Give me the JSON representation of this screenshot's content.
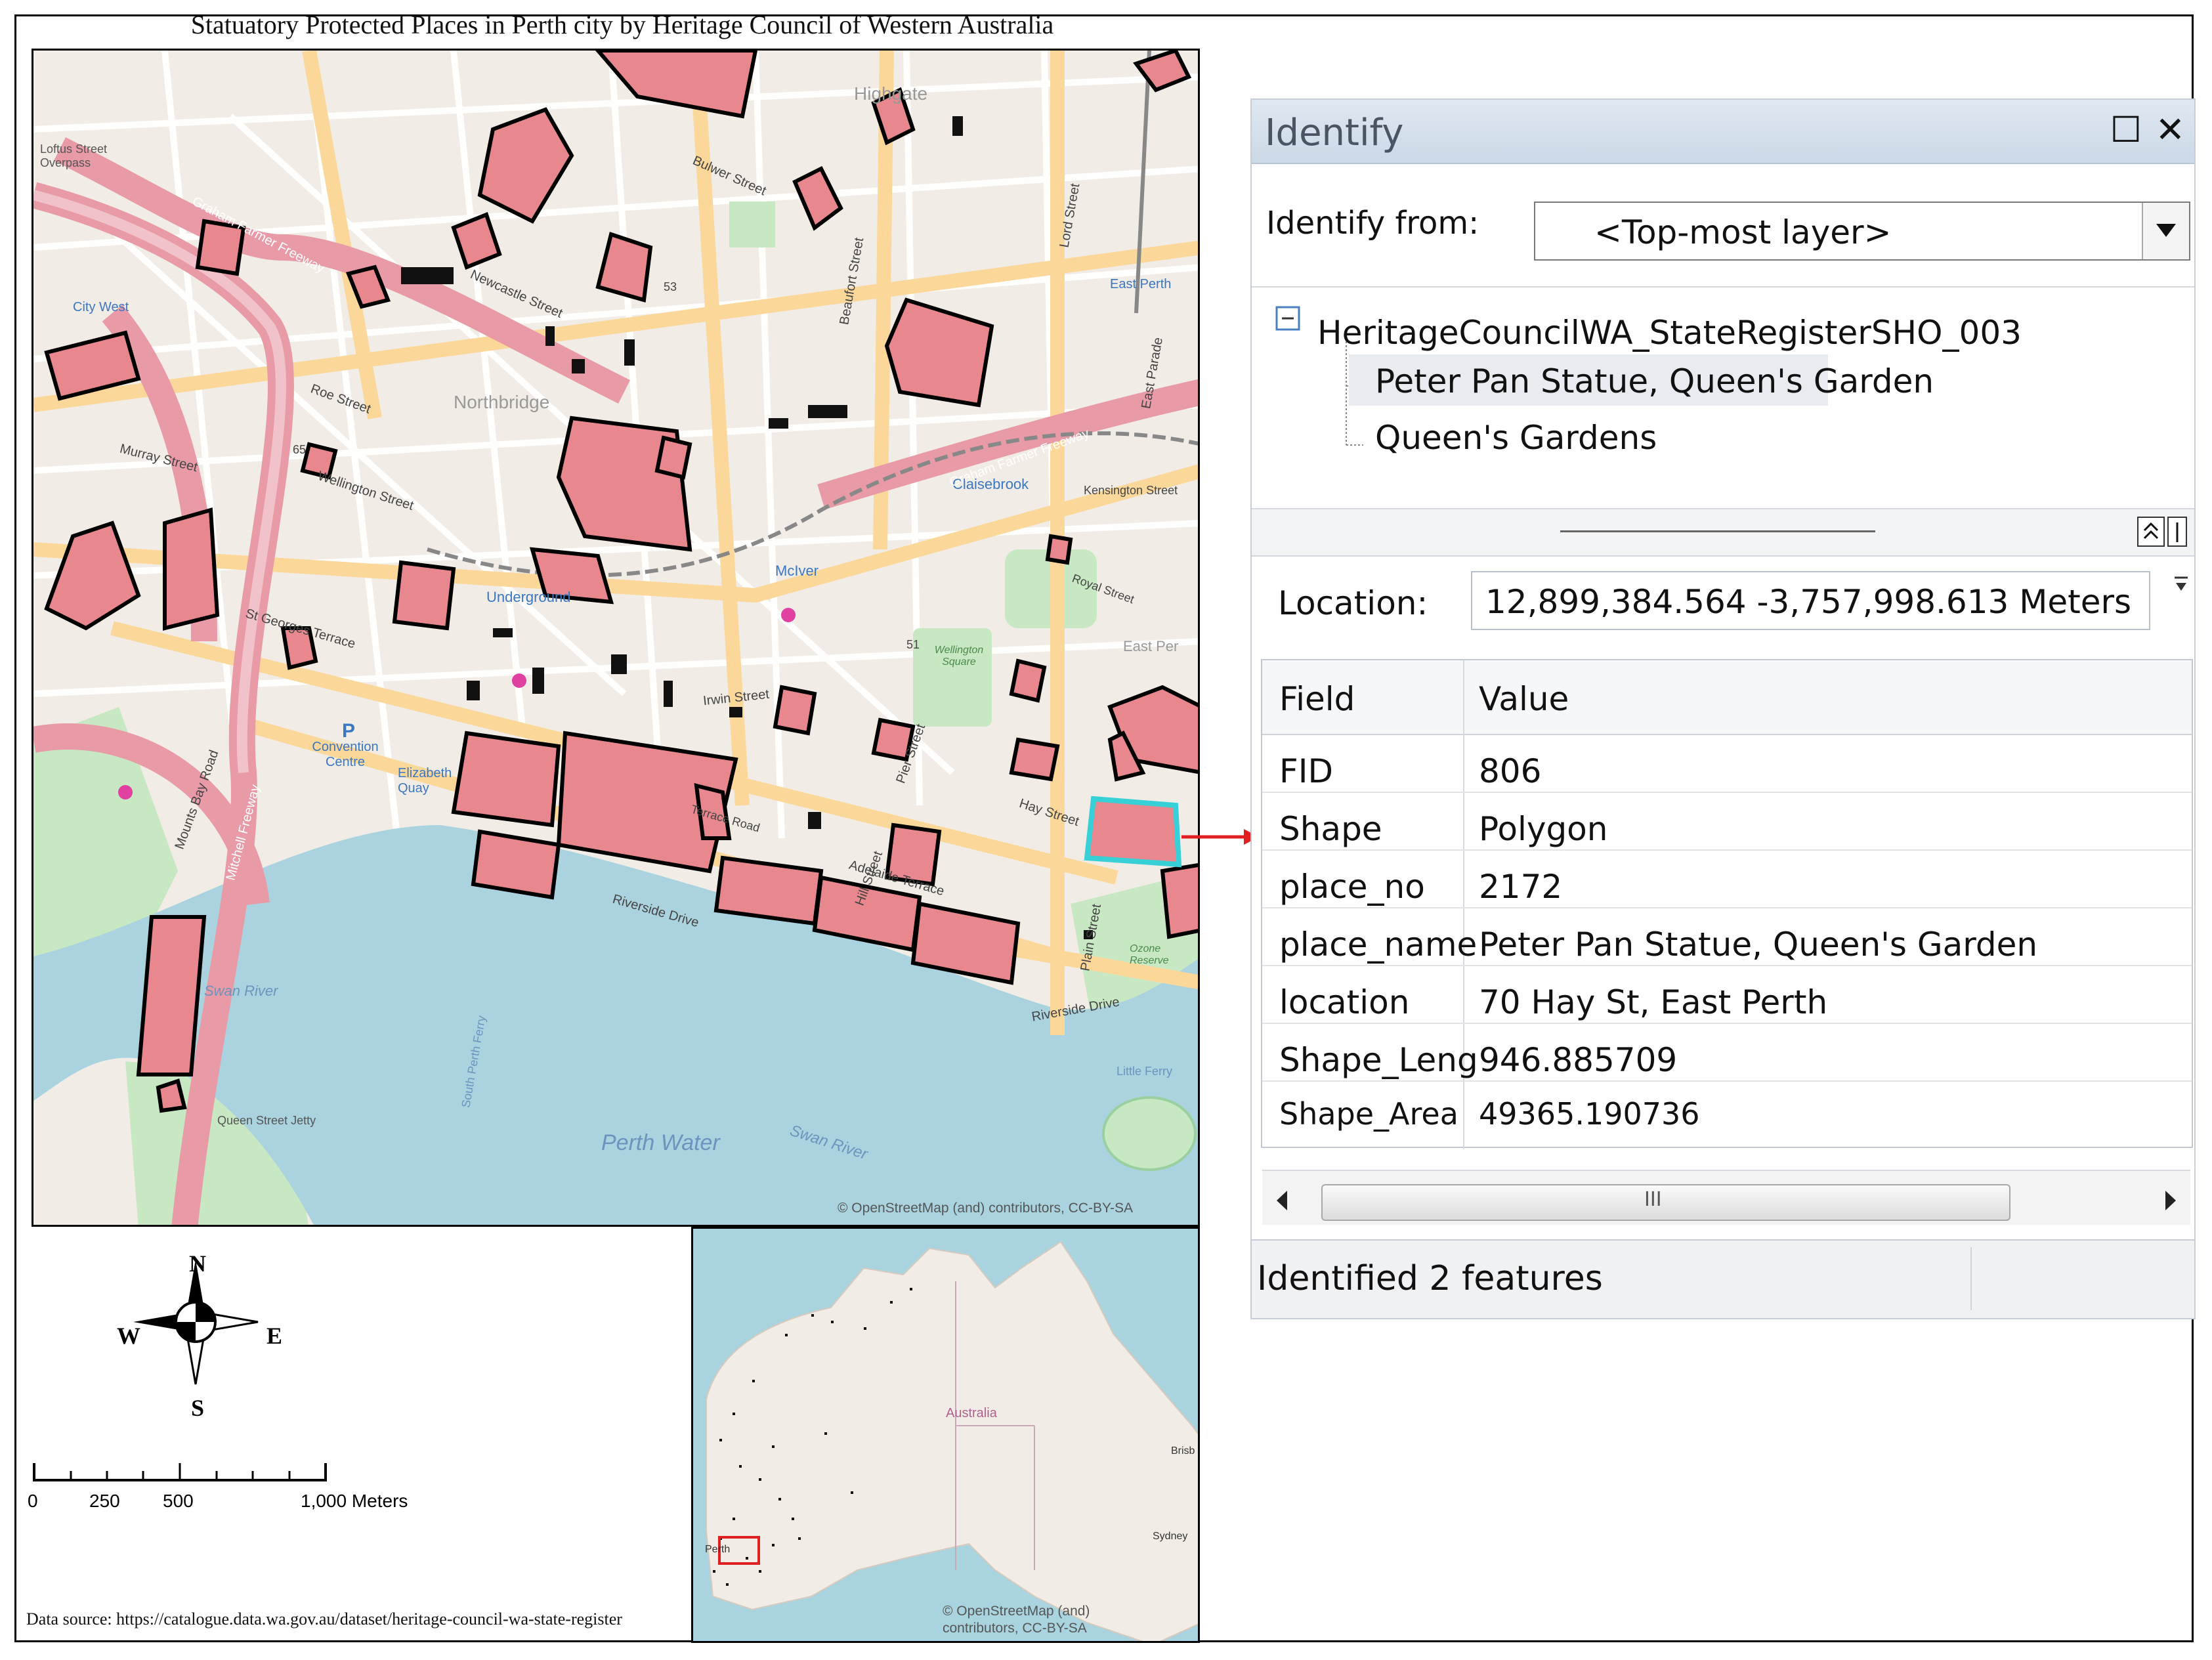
{
  "map": {
    "title": "Statuatory Protected Places in Perth city by Heritage Council of Western Australia",
    "attribution": "© OpenStreetMap (and) contributors, CC-BY-SA",
    "data_source": "Data source: https://catalogue.data.wa.gov.au/dataset/heritage-council-wa-state-register",
    "place_labels": {
      "highgate": "Highgate",
      "northbridge": "Northbridge",
      "east_perth": "East Perth",
      "east_perth2": "East Per",
      "claisebrook": "Claisebrook",
      "mciver": "McIver",
      "underground": "Underground",
      "wellington_square": "Wellington Square",
      "perth_water": "Perth Water",
      "swan_river": "Swan River",
      "swan_river2": "Swan River",
      "convention_centre": "Convention Centre",
      "elizabeth_quay": "Elizabeth Quay",
      "city_west": "City West",
      "loftus": "Loftus Street Overpass",
      "queen_street_jetty": "Queen Street Jetty",
      "ozone_reserve": "Ozone Reserve",
      "little_ferry": "Little Ferry",
      "south_perth_ferry": "South Perth Ferry",
      "parking": "P"
    },
    "street_labels": {
      "graham_farmer": "Graham Farmer Freeway",
      "newcastle": "Newcastle Street",
      "roe": "Roe Street",
      "wellington": "Wellington Street",
      "murray": "Murray Street",
      "hay": "Hay Street",
      "st_georges": "St Georges Terrace",
      "adelaide": "Adelaide Terrace",
      "riverside": "Riverside Drive",
      "mounts_bay": "Mounts Bay Road",
      "mitchell": "Mitchell Freeway",
      "beaufort": "Beaufort Street",
      "lord": "Lord Street",
      "bulwer": "Bulwer Street",
      "pier": "Pier Street",
      "hill": "Hill Street",
      "plain": "Plain Street",
      "irwin": "Irwin Street",
      "terrace_road": "Terrace Road",
      "east_parade": "East Parade",
      "kensington": "Kensington Street",
      "royal": "Royal Street",
      "fifty_three": "53",
      "fifty_one": "51",
      "sixty_five": "65"
    },
    "compass": {
      "n": "N",
      "s": "S",
      "e": "E",
      "w": "W"
    },
    "scalebar": {
      "t0": "0",
      "t1": "250",
      "t2": "500",
      "t3": "1,000 Meters"
    },
    "inset": {
      "label_australia": "Australia",
      "label_perth": "Perth",
      "label_sydney": "Sydney",
      "label_brisbane": "Brisb",
      "attribution": "© OpenStreetMap (and) contributors, CC-BY-SA"
    },
    "colors": {
      "heritage_fill": "#e8878d",
      "major_road": "#e89aa6",
      "secondary_road": "#fbd79a",
      "water": "#aad3df",
      "land": "#f2ece6",
      "park": "#c8e8c4"
    }
  },
  "identify": {
    "title": "Identify",
    "maximize_icon": "☐",
    "close_icon": "✕",
    "from_label": "Identify from:",
    "from_value": "<Top-most layer>",
    "tree": {
      "layer": "HeritageCouncilWA_StateRegisterSHO_003",
      "items": [
        "Peter Pan Statue, Queen's Garden",
        "Queen's Gardens"
      ]
    },
    "location_label": "Location:",
    "location_value": "12,899,384.564  -3,757,998.613 Meters",
    "table": {
      "headers": [
        "Field",
        "Value"
      ],
      "rows": [
        [
          "FID",
          "806"
        ],
        [
          "Shape",
          "Polygon"
        ],
        [
          "place_no",
          "2172"
        ],
        [
          "place_name",
          "Peter Pan Statue, Queen's Garden"
        ],
        [
          "location",
          "70 Hay St, East Perth"
        ],
        [
          "Shape_Leng",
          "946.885709"
        ],
        [
          "Shape_Area",
          "49365.190736"
        ]
      ],
      "scroll_grip": "III"
    },
    "status": "Identified 2 features"
  }
}
